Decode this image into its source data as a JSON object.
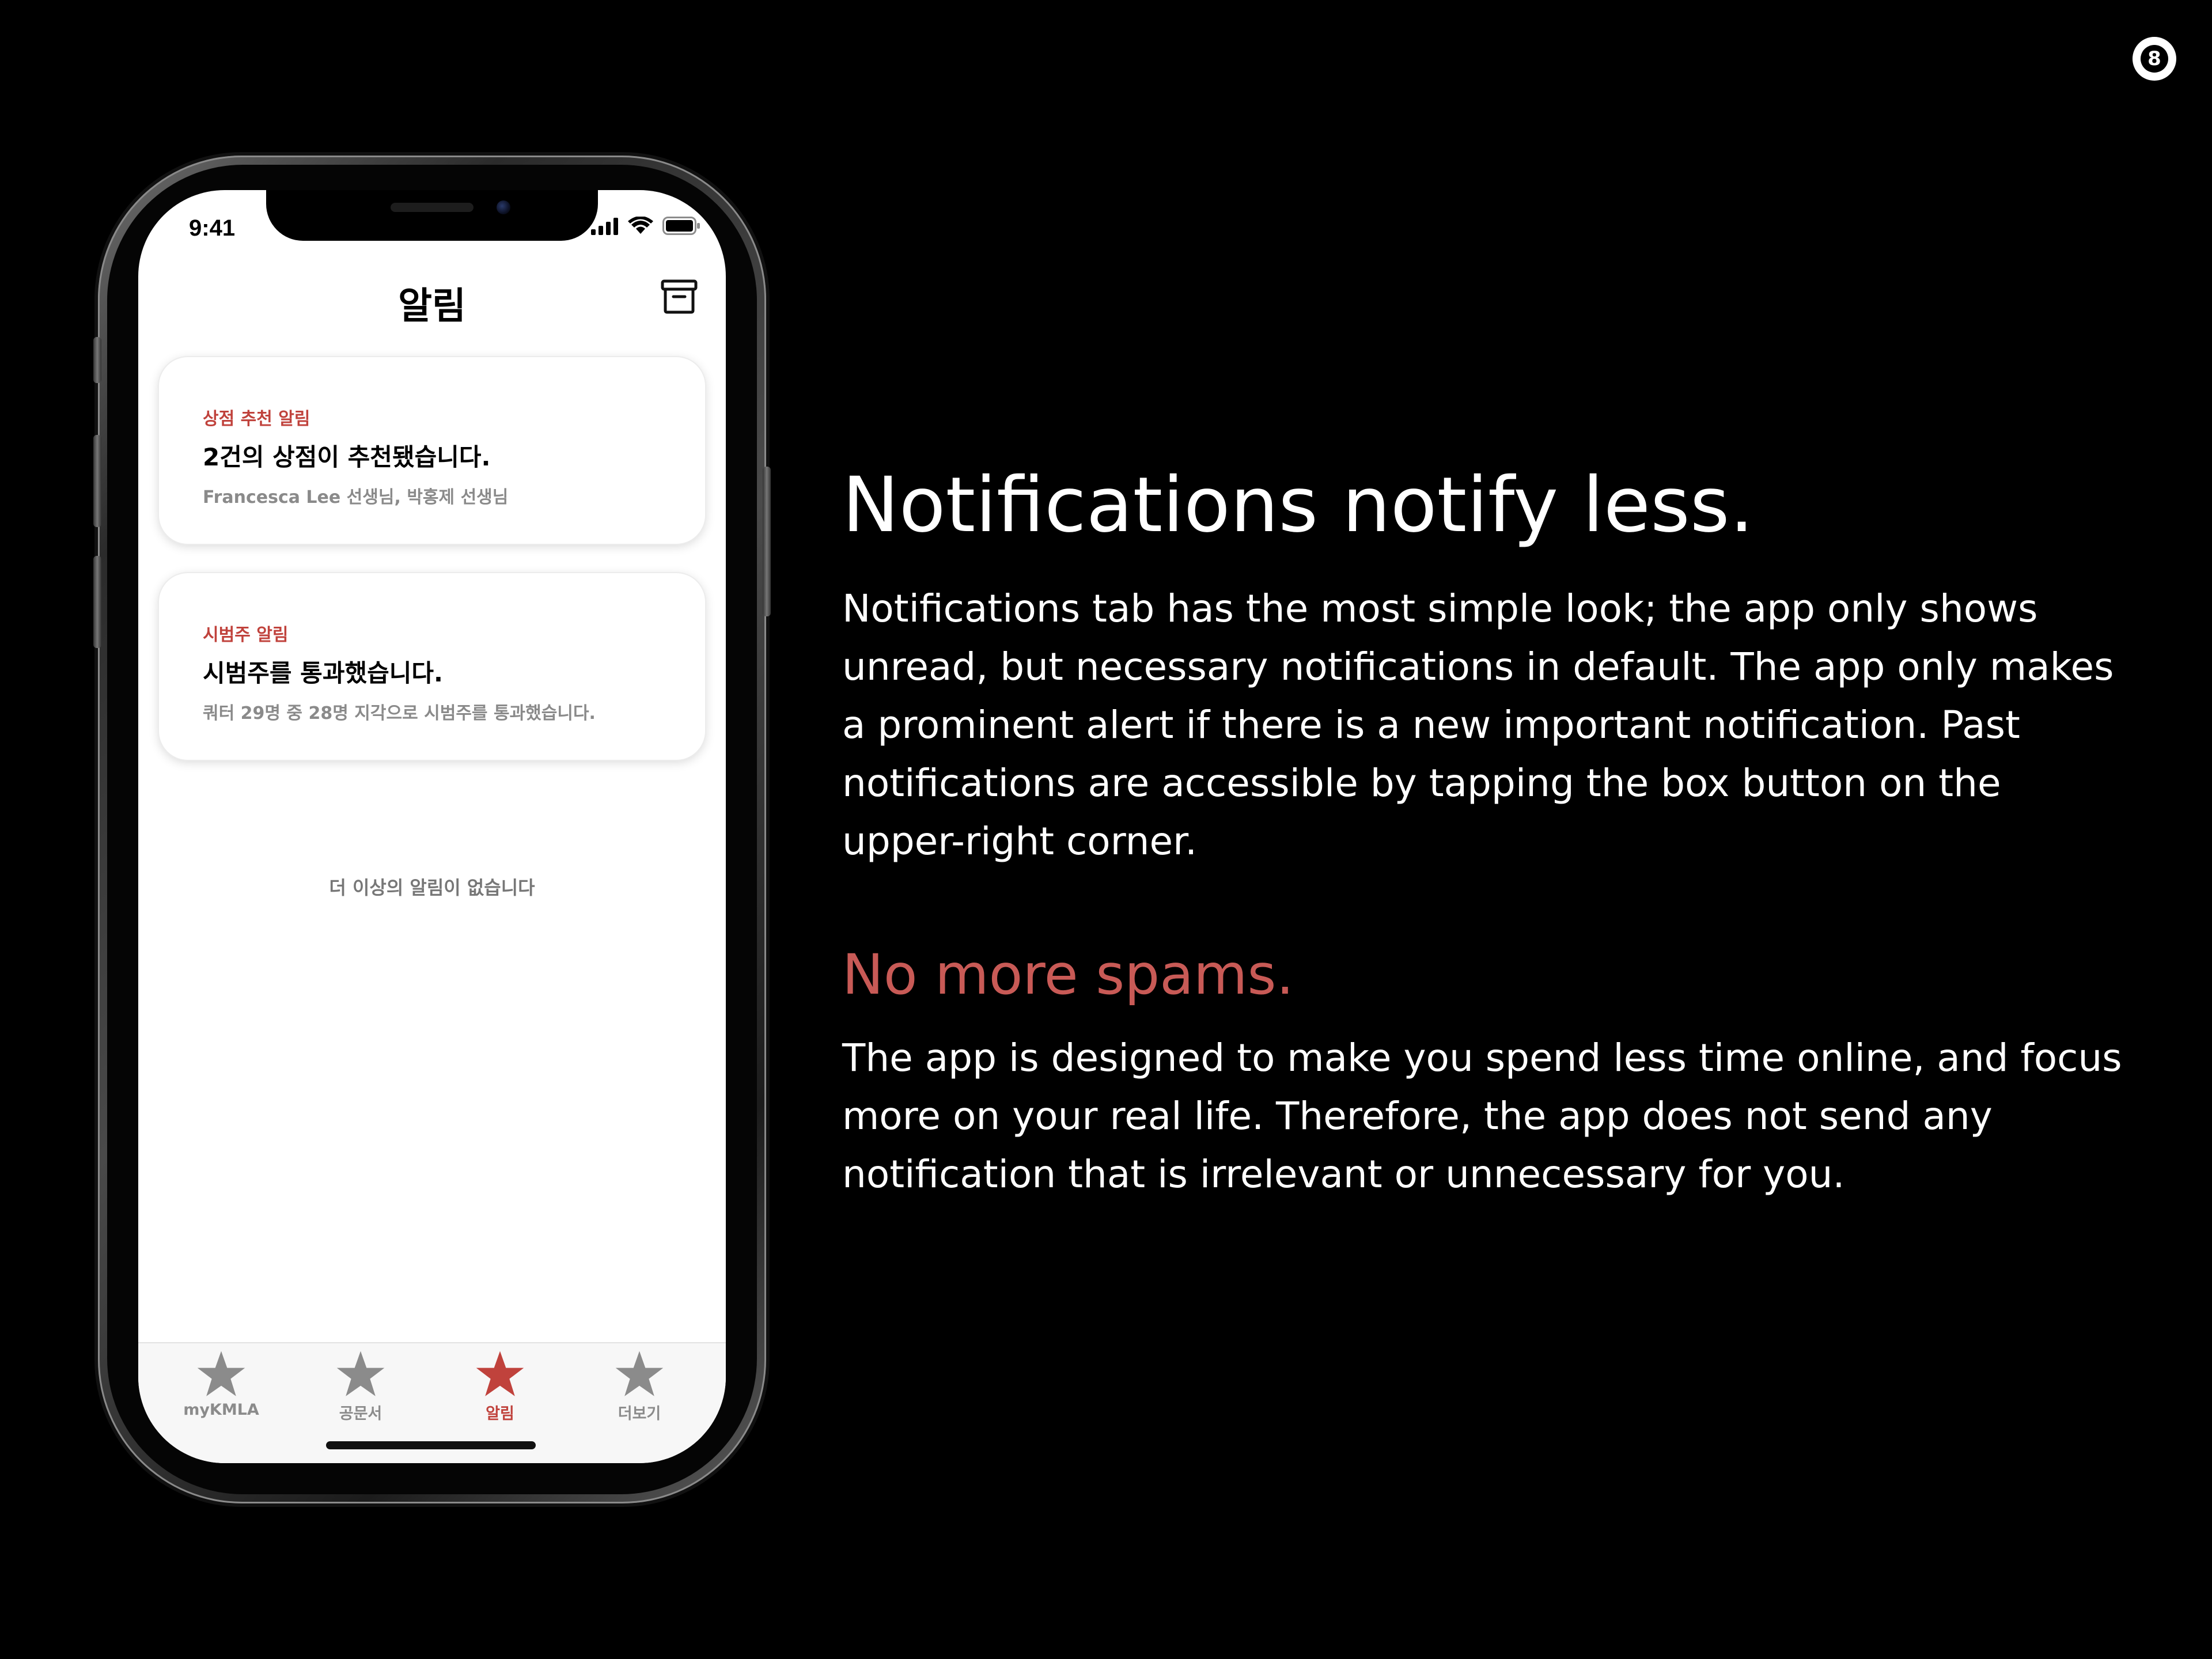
{
  "slide": {
    "page_number": "8",
    "heading": "Notifications notify less.",
    "paragraph_1": "Notifications tab has the most simple look; the app only shows unread, but necessary notifications in default. The app only makes a prominent alert if there is a new important notification. Past notifications are accessible by tapping the box button on the upper-right corner.",
    "sub_heading": "No more spams.",
    "paragraph_2": "The app is designed to make you spend less time online, and focus more on your real life. Therefore, the app does not send any notification that is irrelevant or unnecessary for you.",
    "accent_color": "#c85a56"
  },
  "app": {
    "status_bar": {
      "time": "9:41",
      "icons": [
        "cellular-signal-icon",
        "wifi-icon",
        "battery-icon"
      ]
    },
    "nav": {
      "title": "알림",
      "archive_icon": "archive-box-icon"
    },
    "notifications": [
      {
        "category": "상점 추천 알림",
        "headline": "2건의 상점이 추천됐습니다.",
        "detail": "Francesca Lee 선생님, 박홍제 선생님"
      },
      {
        "category": "시범주 알림",
        "headline": "시범주를 통과했습니다.",
        "detail": "쿼터 29명 중 28명 지각으로 시범주를 통과했습니다."
      }
    ],
    "empty_note": "더 이상의 알림이 없습니다",
    "tabs": [
      {
        "label": "myKMLA",
        "icon": "star-icon",
        "active": false
      },
      {
        "label": "공문서",
        "icon": "star-icon",
        "active": false
      },
      {
        "label": "알림",
        "icon": "star-icon",
        "active": true
      },
      {
        "label": "더보기",
        "icon": "star-icon",
        "active": false
      }
    ],
    "colors": {
      "active_tab": "#c0423c",
      "inactive_tab": "#8b8b8b",
      "category_text": "#c0423c"
    }
  }
}
